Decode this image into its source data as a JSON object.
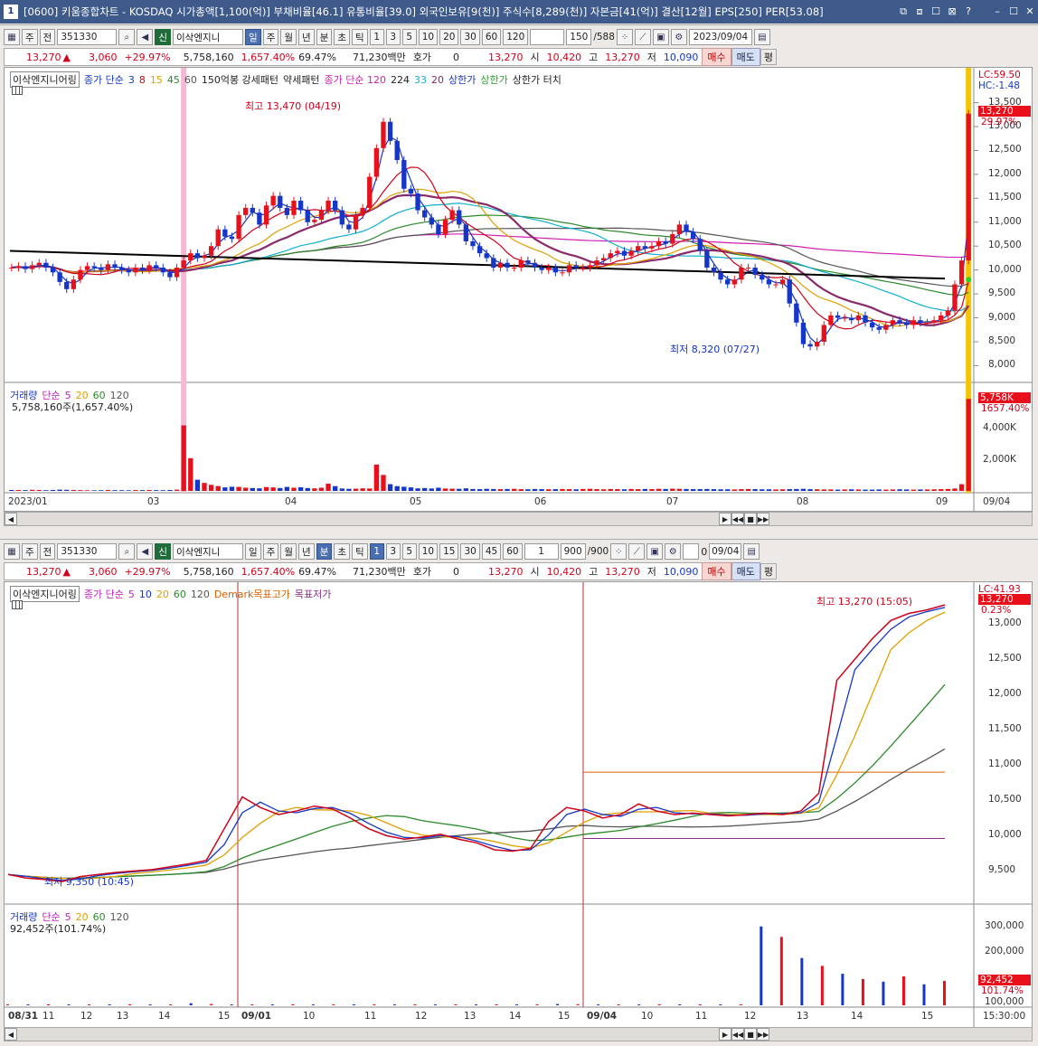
{
  "window": {
    "num": "1",
    "title": "[0600] 키움종합차트 - KOSDAQ 시가총액[1,100(억)] 부채비율[46.1] 유통비율[39.0] 외국인보유[9(천)] 주식수[8,289(천)] 자본금[41(억)] 결산[12월] EPS[250] PER[53.08]",
    "buttons": [
      "⧉",
      "⧈",
      "☐",
      "⊠",
      "?",
      "–",
      "☐",
      "✕"
    ]
  },
  "top": {
    "toolbar": {
      "type": "주",
      "full": "전",
      "code": "351330",
      "badge": "신",
      "name": "이삭엔지니",
      "periods": [
        "일",
        "주",
        "월",
        "년",
        "분",
        "초",
        "틱"
      ],
      "selected_period": "일",
      "nums": [
        "1",
        "3",
        "5",
        "10",
        "20",
        "30",
        "60",
        "120"
      ],
      "count": "150",
      "total": "/588",
      "date": "2023/09/04"
    },
    "info": {
      "price": "13,270",
      "arrow": "▲",
      "change": "3,060",
      "rate": "+29.97%",
      "volume": "5,758,160",
      "vol_rate": "1,657.40%",
      "turnover": "69.47%",
      "amount": "71,230백만",
      "hoga_label": "호가",
      "hoga": "0",
      "cur": "13,270",
      "open_label": "시",
      "open": "10,420",
      "high_label": "고",
      "high": "13,270",
      "low_label": "저",
      "low": "10,090",
      "buy": "매수",
      "sell": "매도",
      "flat": "평"
    },
    "legend": {
      "name": "이삭엔지니어링",
      "ma": "종가 단순",
      "ma1": "3",
      "ma2": "8",
      "ma3": "15",
      "ma4": "45",
      "ma5": "60",
      "pattern1": "150억봉 강세패턴",
      "pattern2": "약세패턴",
      "ma6": "종가 단순 120",
      "ma7": "224",
      "ma8": "33",
      "ma9": "20",
      "limit_up": "상한가",
      "limit_up2": "상한가",
      "limit_touch": "상한가 터치"
    },
    "labels": {
      "high": "최고 13,470 (04/19)",
      "low": "최저 8,320 (07/27)",
      "lc": "LC:59.50",
      "hc": "HC:-1.48",
      "cur_tag": "13,270",
      "cur_rate": "29.97%"
    },
    "yaxis": [
      "13,500",
      "13,000",
      "12,500",
      "12,000",
      "11,500",
      "11,000",
      "10,500",
      "10,000",
      "9,500",
      "9,000",
      "8,500",
      "8,000"
    ],
    "vol_legend": {
      "name": "거래량",
      "ma": "단순",
      "a": "5",
      "b": "20",
      "c": "60",
      "d": "120",
      "value": "5,758,160주(1,657.40%)"
    },
    "vol_axis": [
      "4,000K",
      "2,000K"
    ],
    "vol_tag": "5,758K",
    "vol_tag_rate": "1657.40%",
    "xaxis": [
      "2023/01",
      "03",
      "04",
      "05",
      "06",
      "07",
      "08",
      "09",
      "09/04"
    ]
  },
  "bottom": {
    "toolbar": {
      "type": "주",
      "full": "전",
      "code": "351330",
      "badge": "신",
      "name": "이삭엔지니",
      "periods": [
        "일",
        "주",
        "월",
        "년",
        "분",
        "초",
        "틱"
      ],
      "selected_period": "분",
      "nums": [
        "1",
        "3",
        "5",
        "10",
        "15",
        "30",
        "45",
        "60"
      ],
      "interval": "1",
      "count": "900",
      "total": "/900",
      "zero": "0",
      "date": "09/04"
    },
    "info": {
      "price": "13,270",
      "arrow": "▲",
      "change": "3,060",
      "rate": "+29.97%",
      "volume": "5,758,160",
      "vol_rate": "1,657.40%",
      "turnover": "69.47%",
      "amount": "71,230백만",
      "hoga_label": "호가",
      "hoga": "0",
      "cur": "13,270",
      "open_label": "시",
      "open": "10,420",
      "high_label": "고",
      "high": "13,270",
      "low_label": "저",
      "low": "10,090",
      "buy": "매수",
      "sell": "매도",
      "flat": "평"
    },
    "legend": {
      "name": "이삭엔지니어링",
      "ma": "종가 단순",
      "a": "5",
      "b": "10",
      "c": "20",
      "d": "60",
      "e": "120",
      "demark_high": "Demark목표고가",
      "demark_low": "목표저가"
    },
    "labels": {
      "high": "최고 13,270 (15:05)",
      "low": "최저 9,350 (10:45)",
      "lc": "LC:41.93",
      "cur_tag": "13,270",
      "cur_rate": "0.23%"
    },
    "yaxis": [
      "13,000",
      "12,500",
      "12,000",
      "11,500",
      "11,000",
      "10,500",
      "10,000",
      "9,500"
    ],
    "vol_legend": {
      "name": "거래량",
      "ma": "단순",
      "a": "5",
      "b": "20",
      "c": "60",
      "d": "120",
      "value": "92,452주(101.74%)"
    },
    "vol_axis": [
      "300,000",
      "200,000",
      "100,000"
    ],
    "vol_tag": "92,452",
    "vol_tag_rate": "101.74%",
    "xaxis": [
      "08/31",
      "11",
      "12",
      "13",
      "14",
      "15",
      "09/01",
      "10",
      "11",
      "12",
      "13",
      "14",
      "15",
      "09/04",
      "10",
      "11",
      "12",
      "13",
      "14",
      "15",
      "15:30:00"
    ]
  },
  "chart_data": [
    {
      "type": "candlestick",
      "title": "이삭엔지니어링 일봉",
      "ylim": [
        7800,
        13700
      ],
      "close": [
        10050,
        10080,
        10020,
        10100,
        10150,
        10050,
        9950,
        9750,
        9600,
        9800,
        10000,
        10080,
        10050,
        10000,
        10120,
        10050,
        10000,
        9950,
        10050,
        10000,
        10100,
        10050,
        9950,
        9850,
        10050,
        10200,
        10350,
        10250,
        10300,
        10500,
        10850,
        10700,
        10650,
        11150,
        11300,
        11200,
        10950,
        11350,
        11550,
        11300,
        11150,
        11450,
        11250,
        11000,
        11050,
        11250,
        11450,
        11250,
        10950,
        10850,
        11150,
        11300,
        11950,
        12550,
        13100,
        12700,
        12300,
        11700,
        11600,
        11250,
        11100,
        10950,
        10750,
        11050,
        11250,
        10950,
        10600,
        10500,
        10350,
        10250,
        10050,
        10150,
        10050,
        10050,
        10200,
        10150,
        10050,
        10000,
        10050,
        9950,
        9950,
        10100,
        10050,
        10050,
        10100,
        10200,
        10250,
        10350,
        10400,
        10300,
        10400,
        10500,
        10450,
        10500,
        10600,
        10550,
        10750,
        10950,
        10800,
        10650,
        10400,
        10050,
        9950,
        9800,
        9700,
        9800,
        10050,
        10050,
        9900,
        9800,
        9700,
        9700,
        9800,
        9300,
        8900,
        8450,
        8400,
        8500,
        8850,
        9050,
        9000,
        9000,
        8950,
        9050,
        8900,
        8800,
        8750,
        8850,
        8950,
        8900,
        8850,
        8950,
        8900,
        8900,
        8950,
        9050,
        9150,
        9700,
        10200,
        13270
      ],
      "volume_k": [
        60,
        55,
        50,
        70,
        60,
        45,
        60,
        80,
        70,
        60,
        50,
        40,
        40,
        45,
        60,
        50,
        45,
        40,
        55,
        50,
        60,
        50,
        45,
        60,
        80,
        4100,
        2050,
        700,
        500,
        380,
        300,
        220,
        260,
        250,
        200,
        180,
        160,
        240,
        220,
        180,
        250,
        200,
        230,
        180,
        160,
        200,
        450,
        300,
        150,
        130,
        140,
        160,
        150,
        1650,
        1000,
        420,
        300,
        260,
        220,
        160,
        180,
        150,
        200,
        150,
        140,
        130,
        160,
        120,
        110,
        130,
        120,
        110,
        120,
        130,
        110,
        100,
        120,
        110,
        100,
        110,
        120,
        110,
        100,
        120,
        130,
        110,
        100,
        120,
        110,
        100,
        120,
        110,
        120,
        110,
        130,
        120,
        140,
        130,
        120,
        110,
        110,
        120,
        110,
        100,
        100,
        90,
        110,
        120,
        110,
        100,
        100,
        90,
        100,
        110,
        120,
        130,
        110,
        100,
        90,
        90,
        80,
        90,
        100,
        90,
        80,
        80,
        90,
        80,
        90,
        100,
        90,
        80,
        90,
        90,
        100,
        110,
        120,
        150,
        420,
        5758
      ]
    },
    {
      "type": "line",
      "title": "이삭엔지니어링 분봉",
      "ylim": [
        9300,
        13400
      ],
      "x_days": [
        "08/31",
        "09/01",
        "09/04"
      ],
      "price_points": [
        9450,
        9400,
        9380,
        9350,
        9420,
        9450,
        9480,
        9500,
        9520,
        9560,
        9600,
        9650,
        10100,
        10550,
        10400,
        10300,
        10350,
        10420,
        10380,
        10250,
        10100,
        10000,
        9950,
        9980,
        10020,
        9950,
        9900,
        9800,
        9780,
        9820,
        10200,
        10400,
        10350,
        10250,
        10300,
        10450,
        10350,
        10300,
        10320,
        10300,
        10280,
        10300,
        10320,
        10300,
        10350,
        10600,
        12200,
        12500,
        12800,
        13050,
        13150,
        13200,
        13270
      ],
      "demark_high": 10900,
      "demark_low": 9960,
      "volume_points": [
        2000,
        2500,
        1800,
        1500,
        2200,
        2000,
        3000,
        2500,
        2000,
        8000,
        5000,
        3000,
        2000,
        2500,
        1500,
        2000,
        3000,
        2500,
        2000,
        1800,
        1500,
        1200,
        1000,
        1500,
        2000,
        1800,
        3000,
        5000,
        4000,
        3000,
        2500,
        2000,
        1800,
        1500,
        1200,
        1000,
        1500,
        300000,
        260000,
        180000,
        150000,
        120000,
        100000,
        90000,
        110000,
        80000,
        92452
      ]
    }
  ]
}
